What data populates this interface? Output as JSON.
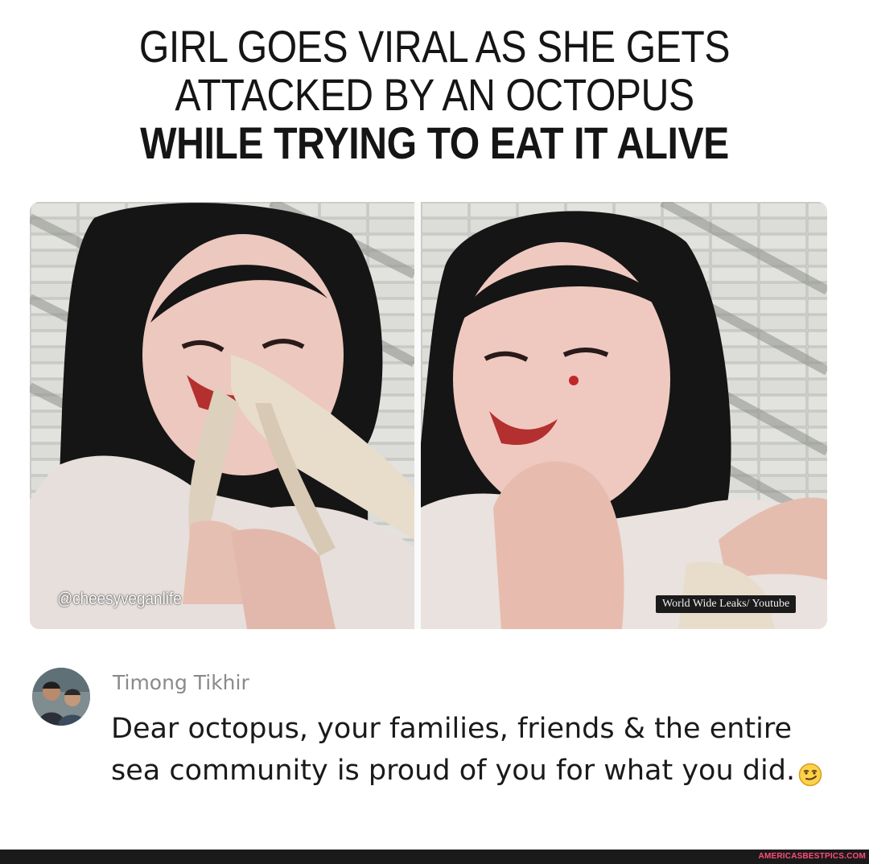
{
  "headline": {
    "line1": "GIRL GOES VIRAL AS SHE GETS",
    "line2": "ATTACKED BY AN OCTOPUS",
    "line3": "WHILE TRYING TO EAT IT ALIVE"
  },
  "photos": {
    "left_watermark": "@cheesyveganlife",
    "right_watermark": "World Wide Leaks/ Youtube"
  },
  "comment": {
    "author": "Timong Tikhir",
    "text": "Dear octopus, your families, friends & the entire sea community is proud of you for what you did.",
    "emoji": "smirking-face"
  },
  "footer": {
    "site": "AMERICASBESTPICS.COM"
  }
}
